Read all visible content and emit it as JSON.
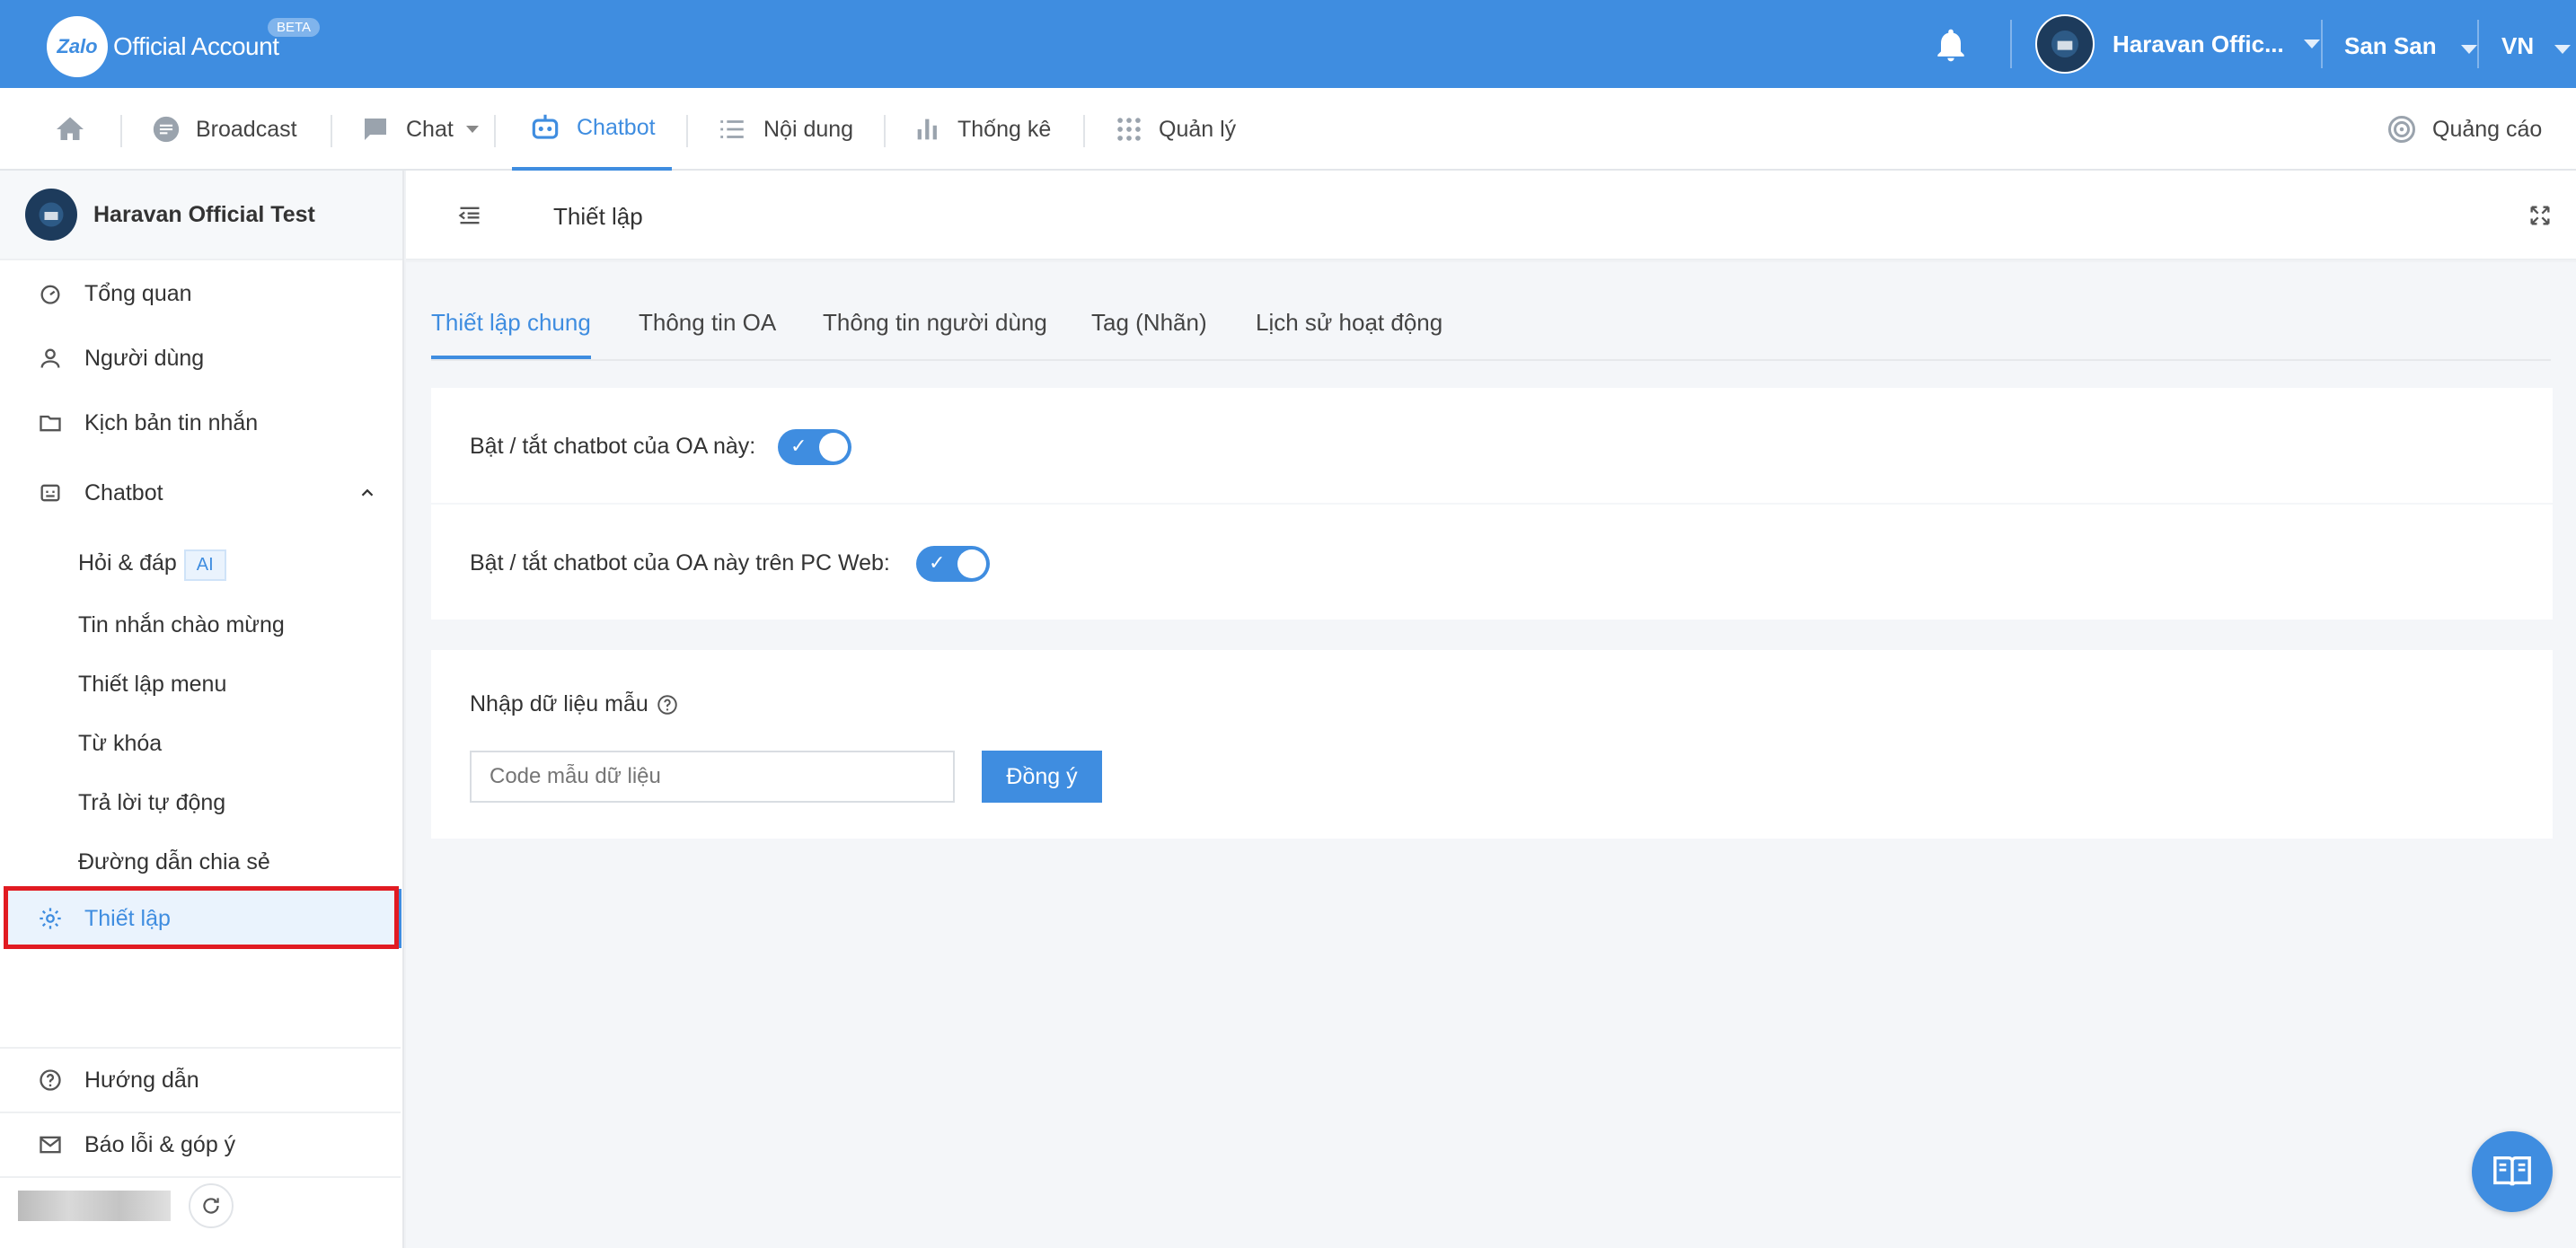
{
  "header": {
    "logo_mark": "Zalo",
    "logo_text": "Official Account",
    "beta_badge": "BETA",
    "account_name": "Haravan Offic...",
    "user_name": "San San",
    "language": "VN"
  },
  "nav": {
    "items": [
      {
        "label": "Broadcast"
      },
      {
        "label": "Chat"
      },
      {
        "label": "Chatbot"
      },
      {
        "label": "Nội dung"
      },
      {
        "label": "Thống kê"
      },
      {
        "label": "Quản lý"
      }
    ],
    "ads_label": "Quảng cáo",
    "active": "Chatbot"
  },
  "sidebar": {
    "oa_name": "Haravan Official Test",
    "items": [
      {
        "label": "Tổng quan"
      },
      {
        "label": "Người dùng"
      },
      {
        "label": "Kịch bản tin nhắn"
      },
      {
        "label": "Chatbot"
      }
    ],
    "sub_items": [
      {
        "label": "Hỏi & đáp",
        "badge": "AI"
      },
      {
        "label": "Tin nhắn chào mừng"
      },
      {
        "label": "Thiết lập menu"
      },
      {
        "label": "Từ khóa"
      },
      {
        "label": "Trả lời tự động"
      },
      {
        "label": "Đường dẫn chia sẻ"
      }
    ],
    "active_item": "Thiết lập",
    "footer": [
      {
        "label": "Hướng dẫn"
      },
      {
        "label": "Báo lỗi & góp ý"
      }
    ]
  },
  "content": {
    "title": "Thiết lập",
    "tabs": [
      {
        "label": "Thiết lập chung"
      },
      {
        "label": "Thông tin OA"
      },
      {
        "label": "Thông tin người dùng"
      },
      {
        "label": "Tag (Nhãn)"
      },
      {
        "label": "Lịch sử hoạt động"
      }
    ],
    "active_tab": "Thiết lập chung",
    "toggles": [
      {
        "label": "Bật / tắt chatbot của OA này:",
        "on": true
      },
      {
        "label": "Bật / tắt chatbot của OA này trên PC Web:",
        "on": true
      }
    ],
    "sample_data": {
      "label": "Nhập dữ liệu mẫu",
      "placeholder": "Code mẫu dữ liệu",
      "button": "Đồng ý"
    }
  },
  "colors": {
    "primary": "#3f8de0",
    "highlight_border": "#e11b22"
  }
}
